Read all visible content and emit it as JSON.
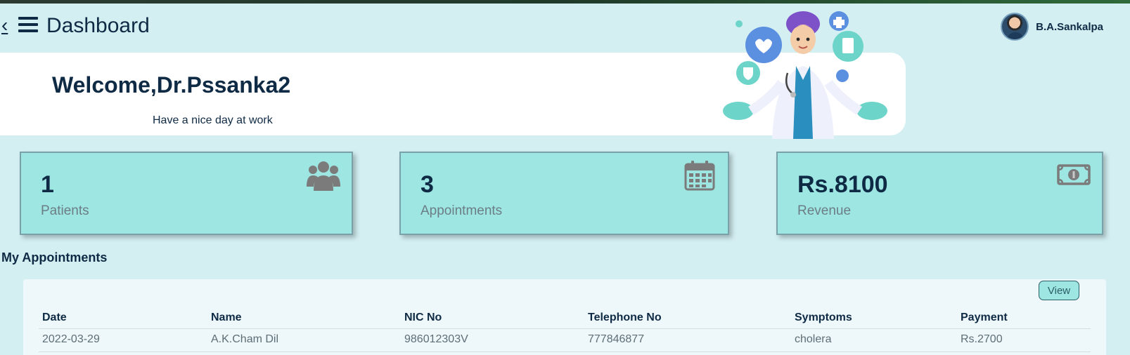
{
  "header": {
    "back_label": "‹",
    "title": "Dashboard",
    "user_name": "B.A.Sankalpa"
  },
  "welcome": {
    "title": "Welcome,Dr.Pssanka2",
    "subtitle": "Have a nice day at work"
  },
  "stats": [
    {
      "value": "1",
      "label": "Patients",
      "icon": "users-icon"
    },
    {
      "value": "3",
      "label": "Appointments",
      "icon": "calendar-icon"
    },
    {
      "value": "Rs.8100",
      "label": "Revenue",
      "icon": "money-icon"
    }
  ],
  "appointments": {
    "section_title": "My Appointments",
    "view_label": "View",
    "columns": [
      "Date",
      "Name",
      "NIC No",
      "Telephone No",
      "Symptoms",
      "Payment"
    ],
    "rows": [
      [
        "2022-03-29",
        "A.K.Cham Dil",
        "986012303V",
        "777846877",
        "cholera",
        "Rs.2700"
      ]
    ]
  },
  "colors": {
    "background": "#d3eff2",
    "card": "#9de6e2",
    "text": "#0f2a44"
  }
}
